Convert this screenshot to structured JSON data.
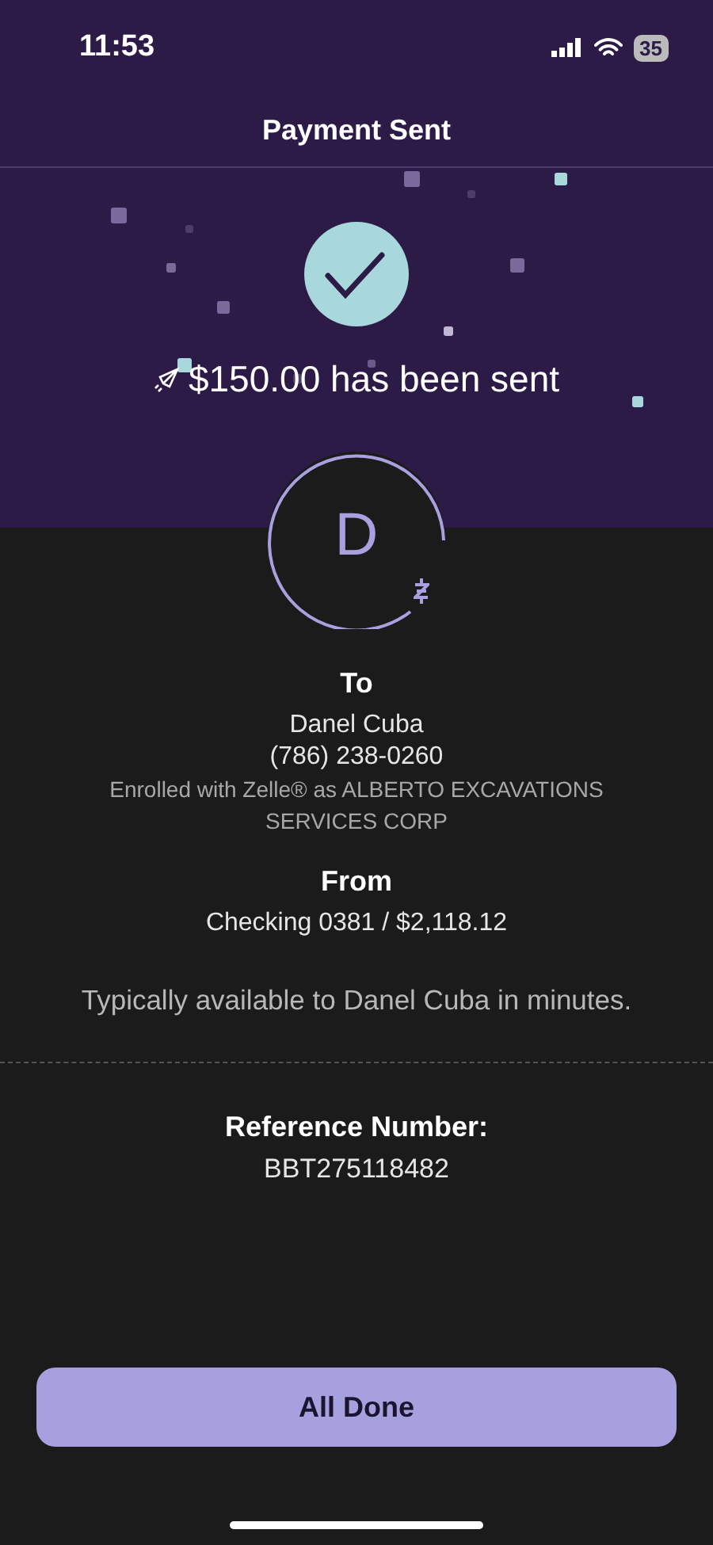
{
  "status_bar": {
    "time": "11:53",
    "battery": "35"
  },
  "header": {
    "title": "Payment Sent"
  },
  "confirmation": {
    "amount": "$150.00 has been sent"
  },
  "recipient": {
    "initial": "D",
    "label": "To",
    "name": "Danel Cuba",
    "phone": "(786) 238-0260",
    "enrollment": "Enrolled with Zelle® as ALBERTO EXCAVATIONS SERVICES CORP"
  },
  "source": {
    "label": "From",
    "account": "Checking 0381 / $2,118.12"
  },
  "availability": "Typically available to Danel Cuba in minutes.",
  "reference": {
    "label": "Reference Number:",
    "number": "BBT275118482"
  },
  "buttons": [
    "All Done"
  ]
}
